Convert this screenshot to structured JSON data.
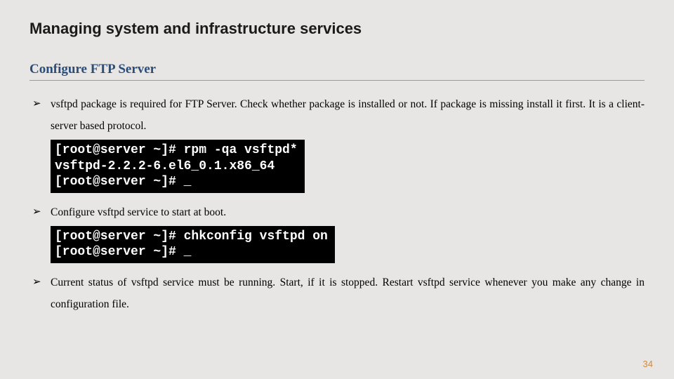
{
  "title": "Managing system and infrastructure services",
  "subtitle": "Configure FTP Server",
  "bullets": {
    "b1": "vsftpd package is required for FTP Server. Check whether package is installed or not. If package is missing install it first. It is a client-server based protocol.",
    "b2": "Configure vsftpd service to start at boot.",
    "b3": "Current status of vsftpd service must be running. Start, if it is stopped. Restart vsftpd service whenever you make any change in configuration file."
  },
  "terminal1": {
    "line1": "[root@server ~]# rpm -qa vsftpd*",
    "line2": "vsftpd-2.2.2-6.el6_0.1.x86_64",
    "line3": "[root@server ~]# _"
  },
  "terminal2": {
    "line1": "[root@server ~]# chkconfig vsftpd on",
    "line2": "[root@server ~]# _"
  },
  "pagenum": "34"
}
